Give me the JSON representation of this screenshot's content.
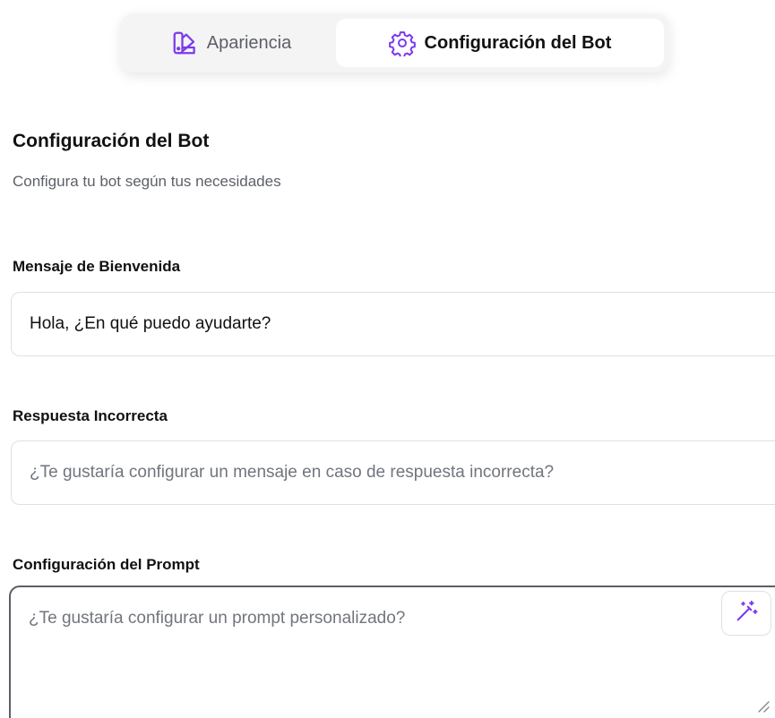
{
  "tabs": {
    "appearance": {
      "label": "Apariencia",
      "icon": "palette-icon"
    },
    "config": {
      "label": "Configuración del Bot",
      "icon": "gear-icon",
      "active": true
    }
  },
  "section": {
    "title": "Configuración del Bot",
    "subtitle": "Configura tu bot según tus necesidades"
  },
  "fields": {
    "welcome": {
      "label": "Mensaje de Bienvenida",
      "value": "Hola, ¿En qué puedo ayudarte?"
    },
    "incorrect": {
      "label": "Respuesta Incorrecta",
      "value": "",
      "placeholder": "¿Te gustaría configurar un mensaje en caso de respuesta incorrecta?"
    },
    "prompt": {
      "label": "Configuración del Prompt",
      "value": "",
      "placeholder": "¿Te gustaría configurar un prompt personalizado?",
      "action_icon": "magic-wand-icon"
    }
  },
  "colors": {
    "accent": "#7c3aed",
    "text": "#111111",
    "muted": "#5d6069"
  }
}
